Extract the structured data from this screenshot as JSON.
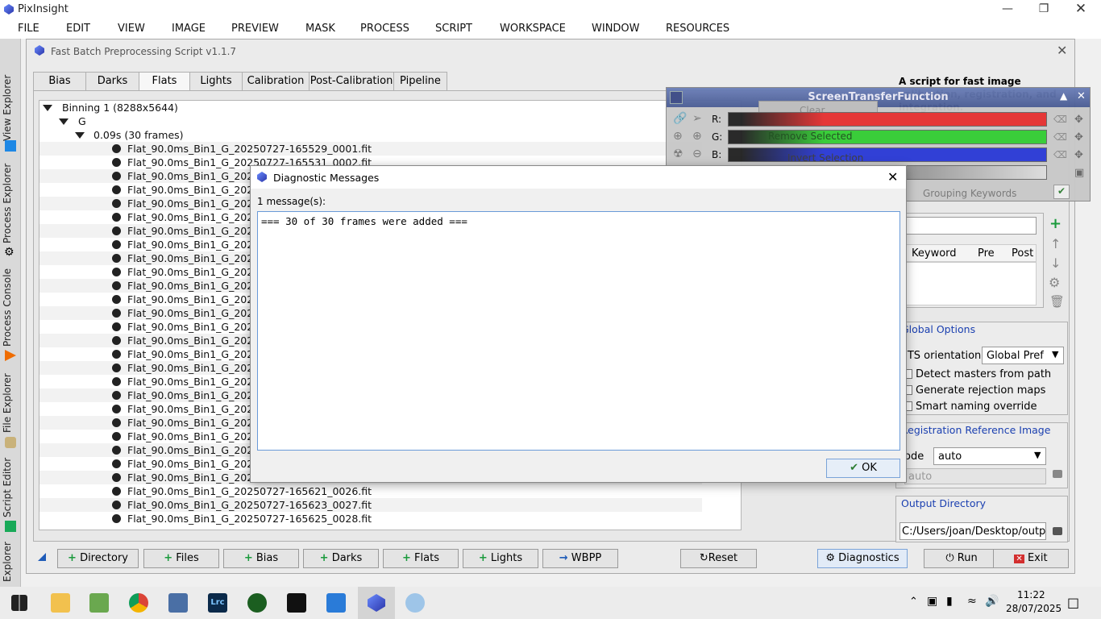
{
  "app": {
    "title": "PixInsight"
  },
  "menu": [
    "FILE",
    "EDIT",
    "VIEW",
    "IMAGE",
    "PREVIEW",
    "MASK",
    "PROCESS",
    "SCRIPT",
    "WORKSPACE",
    "WINDOW",
    "RESOURCES"
  ],
  "dock": {
    "tabs": [
      "View Explorer",
      "Process Explorer",
      "Process Console",
      "File Explorer",
      "Script Editor",
      "Explorer"
    ]
  },
  "script": {
    "title": "Fast Batch Preprocessing Script v1.1.7",
    "tabs": [
      "Bias",
      "Darks",
      "Flats",
      "Lights",
      "Calibration",
      "Post-Calibration",
      "Pipeline"
    ],
    "tree": {
      "binning": "Binning 1 (8288x5644)",
      "filter": "G",
      "exposure": "0.09s (30 frames)",
      "files": [
        "Flat_90.0ms_Bin1_G_20250727-165529_0001.fit",
        "Flat_90.0ms_Bin1_G_20250727-165531_0002.fit",
        "Flat_90.0ms_Bin1_G_202",
        "Flat_90.0ms_Bin1_G_202",
        "Flat_90.0ms_Bin1_G_202",
        "Flat_90.0ms_Bin1_G_202",
        "Flat_90.0ms_Bin1_G_202",
        "Flat_90.0ms_Bin1_G_202",
        "Flat_90.0ms_Bin1_G_202",
        "Flat_90.0ms_Bin1_G_202",
        "Flat_90.0ms_Bin1_G_202",
        "Flat_90.0ms_Bin1_G_202",
        "Flat_90.0ms_Bin1_G_202",
        "Flat_90.0ms_Bin1_G_202",
        "Flat_90.0ms_Bin1_G_202",
        "Flat_90.0ms_Bin1_G_202",
        "Flat_90.0ms_Bin1_G_202",
        "Flat_90.0ms_Bin1_G_202",
        "Flat_90.0ms_Bin1_G_202",
        "Flat_90.0ms_Bin1_G_202",
        "Flat_90.0ms_Bin1_G_202",
        "Flat_90.0ms_Bin1_G_202",
        "Flat_90.0ms_Bin1_G_202",
        "Flat_90.0ms_Bin1_G_202",
        "Flat_90.0ms_Bin1_G_202",
        "Flat_90.0ms_Bin1_G_20250727-165621_0026.fit",
        "Flat_90.0ms_Bin1_G_20250727-165623_0027.fit",
        "Flat_90.0ms_Bin1_G_20250727-165625_0028.fit"
      ]
    },
    "bottom_buttons": [
      "Directory",
      "Files",
      "Bias",
      "Darks",
      "Flats",
      "Lights",
      "WBPP",
      "Reset",
      "Diagnostics",
      "Run",
      "Exit"
    ],
    "right": {
      "description": "A script for fast image calibration, registration, and integration.",
      "grouping_title": "Grouping Keywords",
      "keyword_cols": [
        "Keyword",
        "Pre",
        "Post"
      ],
      "global_title": "Global Options",
      "fits_label": "ITS orientation:",
      "fits_value": "Global Pref",
      "checks": [
        "Detect masters from path",
        "Generate rejection maps",
        "Smart naming override"
      ],
      "reg_title": "Registration Reference Image",
      "mode_label": "ode",
      "mode_value": "auto",
      "ref_placeholder": "auto",
      "out_title": "Output Directory",
      "out_value": "C:/Users/joan/Desktop/output"
    }
  },
  "stf": {
    "title": "ScreenTransferFunction",
    "channels": [
      "R:",
      "G:",
      "B:"
    ],
    "behind_buttons": [
      "Clear",
      "Remove Selected",
      "Invert Selection"
    ]
  },
  "dialog": {
    "title": "Diagnostic Messages",
    "count": "1 message(s):",
    "message": "=== 30 of 30 frames were added ===",
    "ok": "OK"
  },
  "taskbar": {
    "time": "11:22",
    "date": "28/07/2025"
  },
  "colors": {
    "accent": "#1a3fb0",
    "plus": "#1a9a3c",
    "stf_red": "#e53030",
    "stf_green": "#33cc33",
    "stf_blue": "#2a3ad6"
  }
}
